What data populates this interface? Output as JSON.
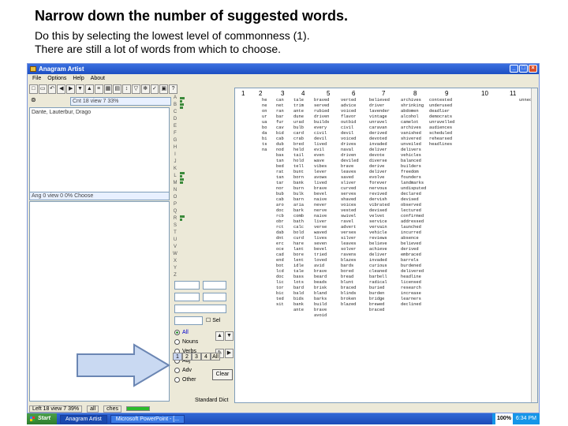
{
  "slide": {
    "title": "Narrow down the number of suggested words.",
    "line1": "Do this by selecting the lowest level of commonness (1).",
    "line2": "There are still a lot of words from which to choose."
  },
  "window": {
    "title": "Anagram Artist",
    "menu": [
      "File",
      "Options",
      "Help",
      "About"
    ]
  },
  "left": {
    "count_top": "Cnt 18 view 7 33%",
    "phrase": "Dante, Lauterbur, Drago",
    "count_bottom": "Ang 0 view 0 0%   Choose"
  },
  "filters": {
    "options": [
      "All",
      "Nouns",
      "Verbs",
      "Adj",
      "Adv",
      "Other"
    ],
    "selected": "All",
    "clear_label": "Clear",
    "levels": [
      "1",
      "2",
      "3",
      "4",
      "All"
    ],
    "selected_level": "1"
  },
  "columns": {
    "headers": [
      "1",
      "2",
      "3",
      "4",
      "5",
      "6",
      "7",
      "8",
      "9",
      "10",
      "11"
    ],
    "words": [
      [
        "he",
        "ne",
        "on",
        "ur",
        "ua",
        "bo",
        "da",
        "bi",
        "ts",
        "na"
      ],
      [
        "can",
        "net",
        "ran",
        "bar",
        "fur",
        "cav",
        "bid",
        "cab",
        "dub",
        "nod",
        "bas",
        "tan",
        "bed",
        "rat",
        "tan",
        "tar",
        "nor",
        "bub",
        "cab",
        "aro",
        "doc",
        "rcb",
        "obr",
        "rct",
        "dab",
        "dnt",
        "erc",
        "oce",
        "cad",
        "end",
        "bot",
        "lcd",
        "doc",
        "lic",
        "tor",
        "bic",
        "ted",
        "sit"
      ],
      [
        "tale",
        "trim",
        "ante",
        "dune",
        "urad",
        "bulb",
        "card",
        "crab",
        "bred",
        "held",
        "tail",
        "hold",
        "tell",
        "bunt",
        "born",
        "bank",
        "burn",
        "bulk",
        "barn",
        "aria",
        "bark",
        "comb",
        "bath",
        "calc",
        "bold",
        "curd",
        "hare",
        "lant",
        "bore",
        "lent",
        "idle",
        "tale",
        "bass",
        "lots",
        "bard",
        "bald",
        "bids",
        "bank",
        "ante"
      ],
      [
        "braved",
        "served",
        "rubied",
        "driven",
        "builds",
        "every",
        "civil",
        "devil",
        "lived",
        "evil",
        "even",
        "wave",
        "vibes",
        "lever",
        "avows",
        "lived",
        "brave",
        "bevel",
        "naive",
        "never",
        "nerve",
        "naive",
        "liver",
        "verse",
        "waved",
        "lives",
        "seven",
        "bevel",
        "tried",
        "loved",
        "avid",
        "brave",
        "beard",
        "beads",
        "brisk",
        "bland",
        "barks",
        "build",
        "brave",
        "avoid"
      ],
      [
        "verted",
        "advice",
        "voiced",
        "flavor",
        "outbid",
        "civil",
        "devil",
        "voiced",
        "drives",
        "naval",
        "driven",
        "deviled",
        "brave",
        "leaves",
        "saved",
        "sliver",
        "curved",
        "serves",
        "shaved",
        "voices",
        "vested",
        "swivel",
        "ravel",
        "advert",
        "verses",
        "silver",
        "leaves",
        "solver",
        "ravens",
        "blazes",
        "bards",
        "bored",
        "bread",
        "blunt",
        "braced",
        "blinds",
        "broken",
        "blazed"
      ],
      [
        "believed",
        "driver",
        "lavender",
        "vintage",
        "unravel",
        "caravan",
        "derived",
        "devoted",
        "invaded",
        "deliver",
        "devote",
        "diverse",
        "derive",
        "deliver",
        "evolve",
        "forever",
        "nervous",
        "revived",
        "dervish",
        "vibrated",
        "devised",
        "velvet",
        "service",
        "vervain",
        "vehicle",
        "reviews",
        "believe",
        "achieve",
        "deliver",
        "invaded",
        "curious",
        "cleaned",
        "barbell",
        "radical",
        "buried",
        "burden",
        "bridge",
        "brewed",
        "braced"
      ],
      [
        "archives",
        "shrinking",
        "abdomen",
        "alcohol",
        "camelot",
        "archives",
        "vanished",
        "shivered",
        "unveiled",
        "delivers",
        "vehicles",
        "balanced",
        "builders",
        "freedom",
        "founders",
        "landmarks",
        "undisputed",
        "declared",
        "devised",
        "observed",
        "lectured",
        "confirmed",
        "addressed",
        "launched",
        "incurred",
        "absence",
        "believed",
        "derived",
        "embraced",
        "barrels",
        "burdened",
        "delivered",
        "headline",
        "licensed",
        "research",
        "increase",
        "learners",
        "declined"
      ],
      [
        "contested",
        "underused",
        "deadlier",
        "democrats",
        "unravelled",
        "audiences",
        "scheduled",
        "rehearsed",
        "headlines"
      ],
      [
        "unnecessarily"
      ]
    ]
  },
  "status": {
    "left": "Left 18 view 7 39%",
    "tab1": "all",
    "tab2": "ches",
    "dict": "Standard Dict"
  },
  "taskbar": {
    "start": "Start",
    "tasks": [
      "Anagram Artist",
      "Microsoft PowerPoint - [..."
    ],
    "zoom": "100%",
    "time": "6:34 PM"
  },
  "colors": {
    "titlebar": "#1d4fc2",
    "highlight_arrow_fill": "#c9d9f2",
    "highlight_arrow_stroke": "#6b86b3"
  }
}
